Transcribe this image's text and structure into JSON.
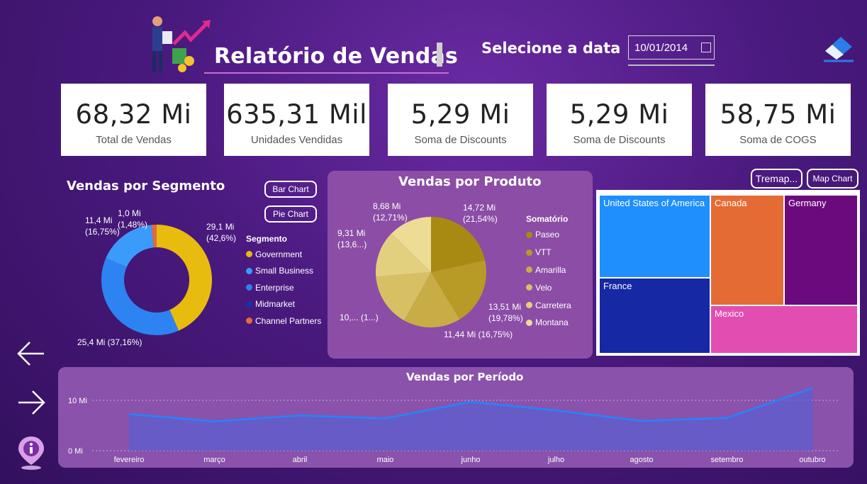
{
  "header": {
    "title": "Relatório de Vendas",
    "date_label": "Selecione a data",
    "date_value": "10/01/2014"
  },
  "kpis": [
    {
      "value": "68,32 Mi",
      "label": "Total de Vendas"
    },
    {
      "value": "635,31 Mil",
      "label": "Unidades Vendidas"
    },
    {
      "value": "5,29 Mi",
      "label": "Soma de Discounts"
    },
    {
      "value": "5,29 Mi",
      "label": "Soma de Discounts"
    },
    {
      "value": "58,75 Mi",
      "label": "Soma de COGS"
    }
  ],
  "buttons": {
    "bar_chart": "Bar Chart",
    "pie_chart": "Pie Chart",
    "treemap": "Tremap...",
    "map_chart": "Map Chart"
  },
  "segment": {
    "title": "Vendas por Segmento",
    "legend_title": "Segmento",
    "items": [
      {
        "name": "Government",
        "color": "#e8bb0f"
      },
      {
        "name": "Small Business",
        "color": "#3a9bfa"
      },
      {
        "name": "Enterprise",
        "color": "#2d83f2"
      },
      {
        "name": "Midmarket",
        "color": "#1a2fa8"
      },
      {
        "name": "Channel Partners",
        "color": "#e46a3c"
      }
    ],
    "labels": {
      "government": "29,1 Mi\n(42,6%)",
      "enterprise": "25,4 Mi (37,16%)",
      "small_business": "11,4 Mi\n(16,75%)",
      "channel": "1,0 Mi\n(1,48%)"
    }
  },
  "product": {
    "title": "Vendas por Produto",
    "legend_title": "Somatório",
    "items": [
      {
        "name": "Paseo",
        "color": "#a88a12"
      },
      {
        "name": "VTT",
        "color": "#b89a26"
      },
      {
        "name": "Amarilla",
        "color": "#c8ad46"
      },
      {
        "name": "Velo",
        "color": "#d7c063"
      },
      {
        "name": "Carretera",
        "color": "#e3d07f"
      },
      {
        "name": "Montana",
        "color": "#ecdc96"
      }
    ],
    "labels": {
      "paseo": "14,72 Mi\n(21,54%)",
      "vtt": "13,51 Mi\n(19,78%)",
      "amarilla": "11,44 Mi (16,75%)",
      "velo": "10,... (1...)",
      "carretera": "9,31 Mi\n(13,6...)",
      "montana": "8,68 Mi\n(12,71%)"
    }
  },
  "treemap": {
    "cells": [
      {
        "name": "United States of America",
        "color": "#1f8ffd"
      },
      {
        "name": "Canada",
        "color": "#e56b35"
      },
      {
        "name": "Germany",
        "color": "#6b0a7d"
      },
      {
        "name": "France",
        "color": "#1628a3"
      },
      {
        "name": "Mexico",
        "color": "#e14db0"
      }
    ]
  },
  "period": {
    "title": "Vendas por Período",
    "y_ticks": [
      "10 Mi",
      "0 Mi"
    ],
    "months": [
      "fevereiro",
      "março",
      "abril",
      "maio",
      "junho",
      "julho",
      "agosto",
      "setembro",
      "outubro"
    ]
  },
  "chart_data": [
    {
      "type": "pie",
      "title": "Vendas por Segmento",
      "categories": [
        "Government",
        "Enterprise",
        "Small Business",
        "Channel Partners"
      ],
      "values": [
        29.1,
        25.4,
        11.4,
        1.0
      ],
      "unit": "Mi",
      "legend": "right"
    },
    {
      "type": "pie",
      "title": "Vendas por Produto",
      "categories": [
        "Paseo",
        "VTT",
        "Amarilla",
        "Velo",
        "Carretera",
        "Montana"
      ],
      "values": [
        14.72,
        13.51,
        11.44,
        10.66,
        9.31,
        8.68
      ],
      "unit": "Mi",
      "legend": "right"
    },
    {
      "type": "area",
      "title": "Vendas por Período",
      "x": [
        "fevereiro",
        "março",
        "abril",
        "maio",
        "junho",
        "julho",
        "agosto",
        "setembro",
        "outubro"
      ],
      "values": [
        7.3,
        5.8,
        7.0,
        6.4,
        9.7,
        8.0,
        5.9,
        6.5,
        12.4
      ],
      "unit": "Mi",
      "ylim": [
        0,
        12.8
      ],
      "grid": true
    }
  ]
}
